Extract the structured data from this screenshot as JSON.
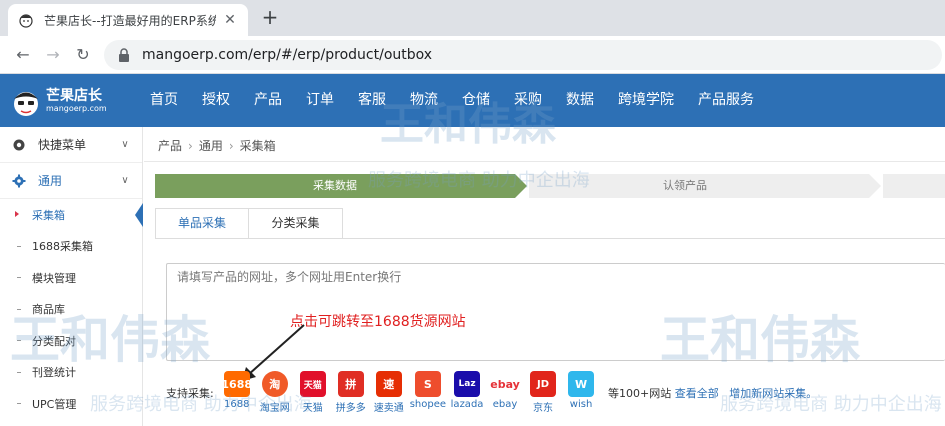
{
  "browser": {
    "tab_title": "芒果店长--打造最好用的ERP系统",
    "url": "mangoerp.com/erp/#/erp/product/outbox"
  },
  "header": {
    "logo_main": "芒果店长",
    "logo_sub": "mangoerp.com",
    "nav": [
      "首页",
      "授权",
      "产品",
      "订单",
      "客服",
      "物流",
      "仓储",
      "采购",
      "数据",
      "跨境学院",
      "产品服务"
    ]
  },
  "sidebar": {
    "groups": [
      {
        "label": "快捷菜单",
        "icon": "gear-icon"
      },
      {
        "label": "通用",
        "icon": "gear-icon"
      }
    ],
    "items": [
      "采集箱",
      "1688采集箱",
      "模块管理",
      "商品库",
      "分类配对",
      "刊登统计",
      "UPC管理"
    ]
  },
  "breadcrumb": [
    "产品",
    "通用",
    "采集箱"
  ],
  "steps": [
    "采集数据",
    "认领产品"
  ],
  "tabs": [
    "单品采集",
    "分类采集"
  ],
  "url_input": {
    "placeholder": "请填写产品的网址，多个网址用Enter换行"
  },
  "annotation": "点击可跳转至1688货源网站",
  "sources": {
    "label": "支持采集:",
    "sites": [
      "1688",
      "淘宝网",
      "天猫",
      "拼多多",
      "速卖通",
      "shopee",
      "lazada",
      "ebay",
      "京东",
      "wish"
    ],
    "icon_texts": [
      "1688",
      "淘",
      "天猫",
      "拼",
      "速",
      "S",
      "Laz",
      "ebay",
      "JD",
      "W"
    ],
    "more_text": "等100+网站",
    "view_all": "查看全部",
    "add_new": "增加新网站采集。"
  },
  "watermark": {
    "brand": "王和伟森",
    "slogan": "服务跨境电商 助力中企出海"
  },
  "colors": {
    "header_blue": "#2d70b5",
    "step_green": "#7a9f5d",
    "annotation_red": "#e02020"
  }
}
